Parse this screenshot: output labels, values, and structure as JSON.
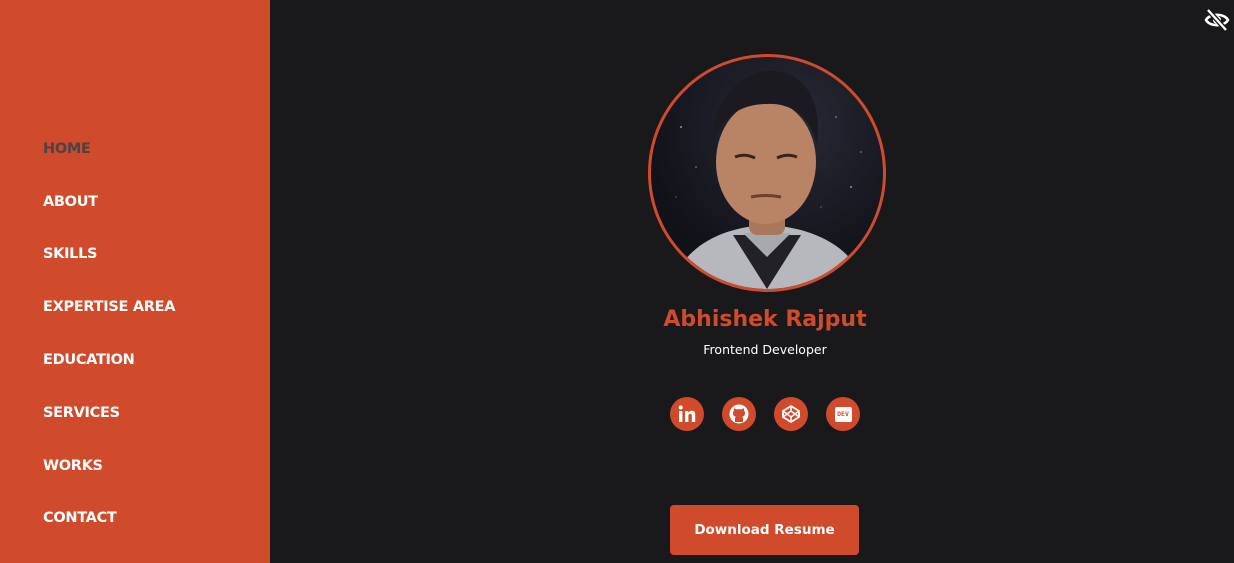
{
  "colors": {
    "accent": "#cf4b2b",
    "background": "#19191b",
    "nav_active": "#4a4443",
    "text": "#ffffff"
  },
  "nav": {
    "items": [
      {
        "label": "HOME",
        "active": true
      },
      {
        "label": "ABOUT",
        "active": false
      },
      {
        "label": "SKILLS",
        "active": false
      },
      {
        "label": "EXPERTISE AREA",
        "active": false
      },
      {
        "label": "EDUCATION",
        "active": false
      },
      {
        "label": "SERVICES",
        "active": false
      },
      {
        "label": "WORKS",
        "active": false
      },
      {
        "label": "CONTACT",
        "active": false
      }
    ]
  },
  "header": {
    "visibility_toggle_icon": "eye-slash-icon"
  },
  "profile": {
    "photo_icon": "profile-photo",
    "name": "Abhishek Rajput",
    "role": "Frontend Developer"
  },
  "socials": [
    {
      "icon": "linkedin-icon"
    },
    {
      "icon": "github-icon"
    },
    {
      "icon": "codepen-icon"
    },
    {
      "icon": "dev-icon",
      "text": "DEV"
    }
  ],
  "actions": {
    "download_label": "Download Resume"
  }
}
